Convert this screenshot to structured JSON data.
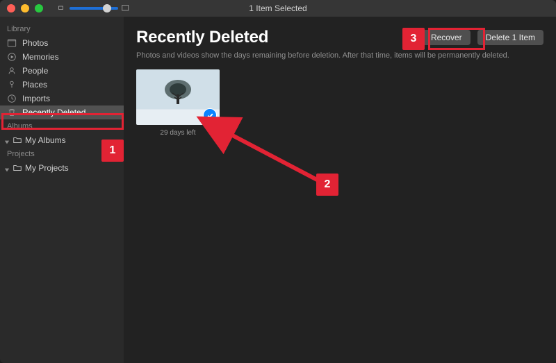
{
  "titlebar": {
    "title": "1 Item Selected"
  },
  "sidebar": {
    "library_label": "Library",
    "items": [
      {
        "label": "Photos"
      },
      {
        "label": "Memories"
      },
      {
        "label": "People"
      },
      {
        "label": "Places"
      },
      {
        "label": "Imports"
      },
      {
        "label": "Recently Deleted"
      }
    ],
    "albums_label": "Albums",
    "my_albums": "My Albums",
    "projects_label": "Projects",
    "my_projects": "My Projects"
  },
  "page": {
    "title": "Recently Deleted",
    "subtitle": "Photos and videos show the days remaining before deletion. After that time, items will be permanently deleted.",
    "recover_label": "Recover",
    "delete_label": "Delete 1 Item"
  },
  "items": [
    {
      "caption": "29 days left",
      "selected": true
    }
  ],
  "annotations": {
    "n1": "1",
    "n2": "2",
    "n3": "3"
  }
}
